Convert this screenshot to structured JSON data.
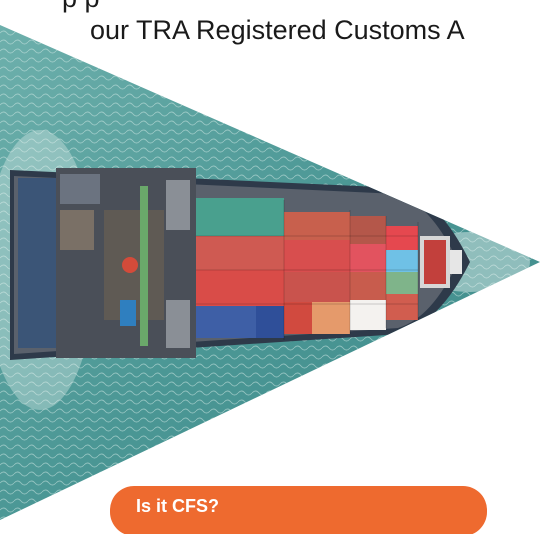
{
  "header": {
    "line1": "p   p",
    "line2": "our TRA Registered Customs A"
  },
  "hero": {
    "image": "container-ship-aerial-photo",
    "colors": {
      "sea": "#4f9c9a",
      "accent": "#ee6a2f"
    }
  },
  "cta": {
    "label": "Is it CFS?"
  }
}
